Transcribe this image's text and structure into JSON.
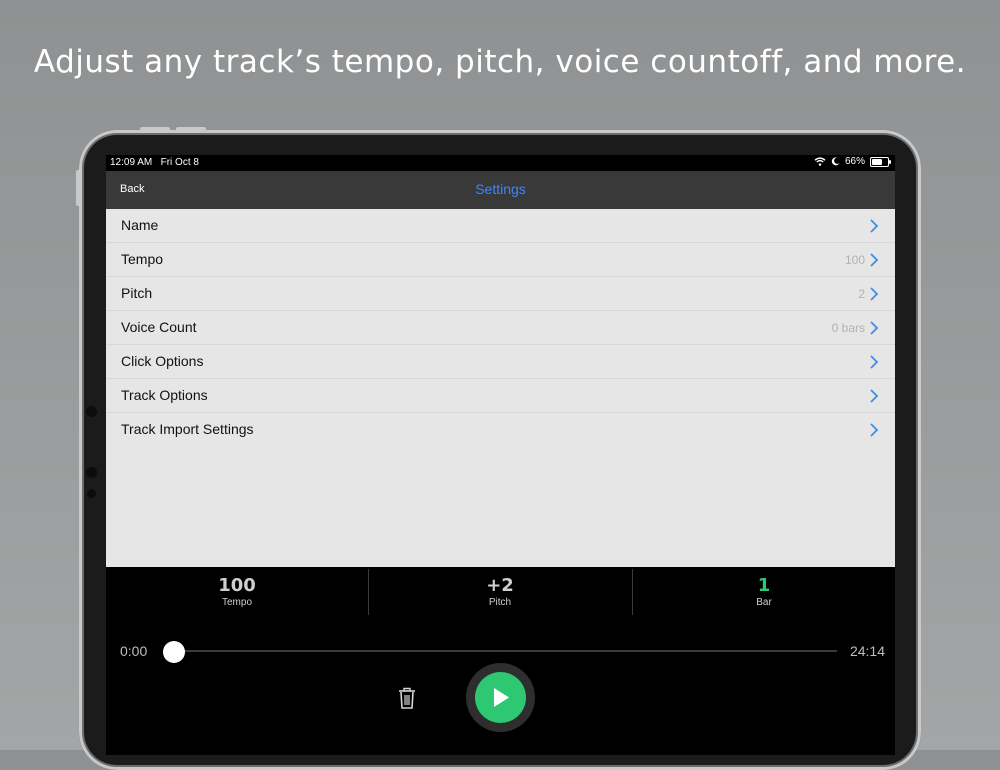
{
  "headline": "Adjust any track’s tempo, pitch, voice countoff, and more.",
  "status_bar": {
    "time": "12:09 AM",
    "date": "Fri Oct 8",
    "battery": "66%",
    "icons": [
      "wifi-icon",
      "moon-icon",
      "battery-icon"
    ]
  },
  "nav": {
    "back_label": "Back",
    "title": "Settings",
    "title_color": "#3a86ff"
  },
  "settings": {
    "rows": [
      {
        "label": "Name",
        "value": ""
      },
      {
        "label": "Tempo",
        "value": "100"
      },
      {
        "label": "Pitch",
        "value": "2"
      },
      {
        "label": "Voice Count",
        "value": "0 bars"
      },
      {
        "label": "Click Options",
        "value": ""
      },
      {
        "label": "Track Options",
        "value": ""
      },
      {
        "label": "Track Import Settings",
        "value": ""
      }
    ]
  },
  "player": {
    "stats": [
      {
        "value": "100",
        "label": "Tempo"
      },
      {
        "value": "+2",
        "label": "Pitch"
      },
      {
        "value": "1",
        "label": "Bar",
        "color": "#2ec873"
      }
    ],
    "time_start": "0:00",
    "time_end": "24:14",
    "progress": 0,
    "play_color": "#2ec873",
    "icons": [
      "trash-icon",
      "play-icon"
    ]
  }
}
